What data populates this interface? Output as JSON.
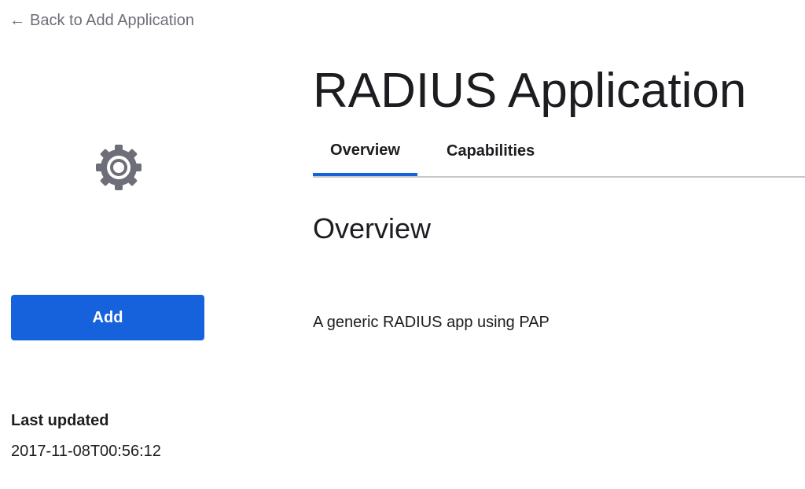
{
  "nav": {
    "back_arrow": "←",
    "back_label": "Back to Add Application"
  },
  "app": {
    "icon": "gear-icon",
    "title": "RADIUS Application",
    "add_label": "Add",
    "last_updated_label": "Last updated",
    "last_updated_value": "2017-11-08T00:56:12"
  },
  "tabs": [
    {
      "label": "Overview",
      "active": true
    },
    {
      "label": "Capabilities",
      "active": false
    }
  ],
  "overview": {
    "heading": "Overview",
    "description": "A generic RADIUS app using PAP"
  },
  "colors": {
    "accent": "#1662dd",
    "icon_gray": "#6e6e78",
    "text": "#1d1d21",
    "divider": "#c8c8cc"
  }
}
